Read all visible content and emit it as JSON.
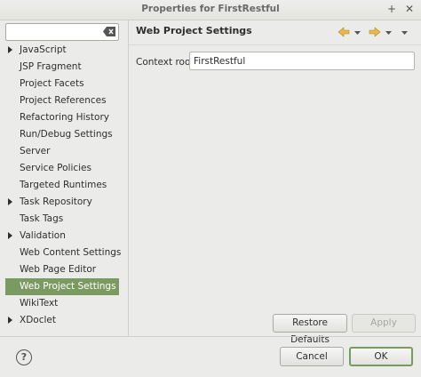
{
  "window": {
    "title": "Properties for FirstRestful",
    "maximize_glyph": "+",
    "close_glyph": "✕"
  },
  "filter": {
    "value": "",
    "placeholder": ""
  },
  "tree": {
    "items": [
      {
        "label": "JavaScript",
        "expandable": true
      },
      {
        "label": "JSP Fragment",
        "expandable": false
      },
      {
        "label": "Project Facets",
        "expandable": false
      },
      {
        "label": "Project References",
        "expandable": false
      },
      {
        "label": "Refactoring History",
        "expandable": false
      },
      {
        "label": "Run/Debug Settings",
        "expandable": false
      },
      {
        "label": "Server",
        "expandable": false
      },
      {
        "label": "Service Policies",
        "expandable": false
      },
      {
        "label": "Targeted Runtimes",
        "expandable": false
      },
      {
        "label": "Task Repository",
        "expandable": true
      },
      {
        "label": "Task Tags",
        "expandable": false
      },
      {
        "label": "Validation",
        "expandable": true
      },
      {
        "label": "Web Content Settings",
        "expandable": false
      },
      {
        "label": "Web Page Editor",
        "expandable": false
      },
      {
        "label": "Web Project Settings",
        "expandable": false,
        "selected": true
      },
      {
        "label": "WikiText",
        "expandable": false
      },
      {
        "label": "XDoclet",
        "expandable": true
      }
    ]
  },
  "page": {
    "title": "Web Project Settings",
    "context_root_label": "Context root:",
    "context_root_value": "FirstRestful"
  },
  "buttons": {
    "restore_defaults": "Restore Defaults",
    "apply": "Apply",
    "cancel": "Cancel",
    "ok": "OK",
    "help": "?"
  },
  "colors": {
    "selection": "#7a9a62",
    "nav_arrow": "#e8b84a"
  }
}
